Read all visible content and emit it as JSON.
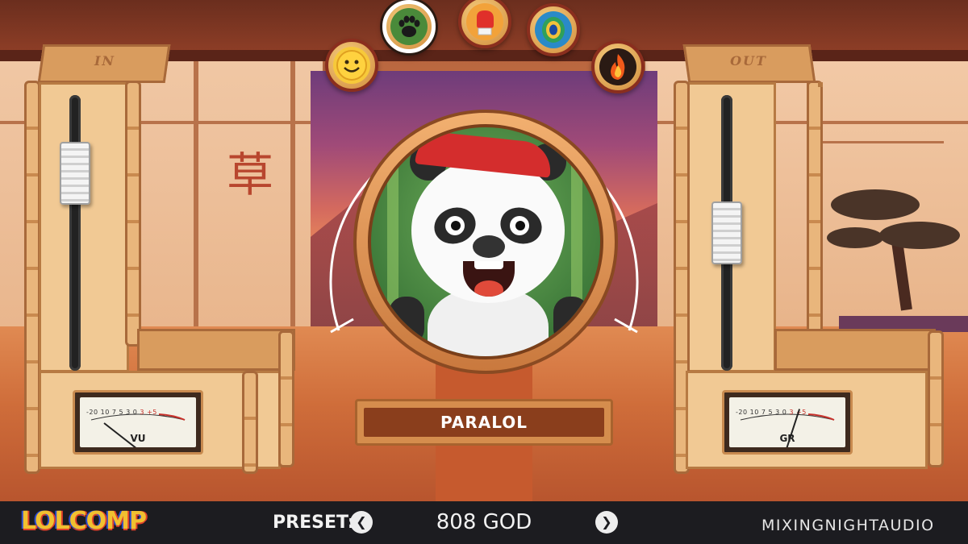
{
  "app": {
    "logo": "LOLCOMP",
    "brand": "MIXINGNIGHTAUDIO"
  },
  "panels": {
    "input": {
      "label": "IN",
      "meter_label": "VU",
      "slider_level": 0.78
    },
    "output": {
      "label": "OUT",
      "meter_label": "GR",
      "slider_level": 0.5
    }
  },
  "meter_scale": [
    "-20",
    "10",
    "7",
    "5",
    "3",
    "0",
    "3",
    "+5"
  ],
  "modes": [
    {
      "name": "smile",
      "icon": "smiley-face-icon",
      "active": false
    },
    {
      "name": "paw",
      "icon": "paw-print-icon",
      "active": true
    },
    {
      "name": "boxing",
      "icon": "boxing-glove-icon",
      "active": false
    },
    {
      "name": "peacock",
      "icon": "peacock-feather-icon",
      "active": false
    },
    {
      "name": "fire",
      "icon": "fire-icon",
      "active": false
    }
  ],
  "character": {
    "name": "PARALOL"
  },
  "preset": {
    "label": "PRESET:",
    "value": "808 GOD",
    "prev_icon": "chevron-left-icon",
    "next_icon": "chevron-right-icon"
  },
  "colors": {
    "accent_red": "#d42d2d",
    "bamboo": "#e9b67c",
    "bar_bg": "#1c1c20",
    "logo_yellow": "#f0c030"
  }
}
